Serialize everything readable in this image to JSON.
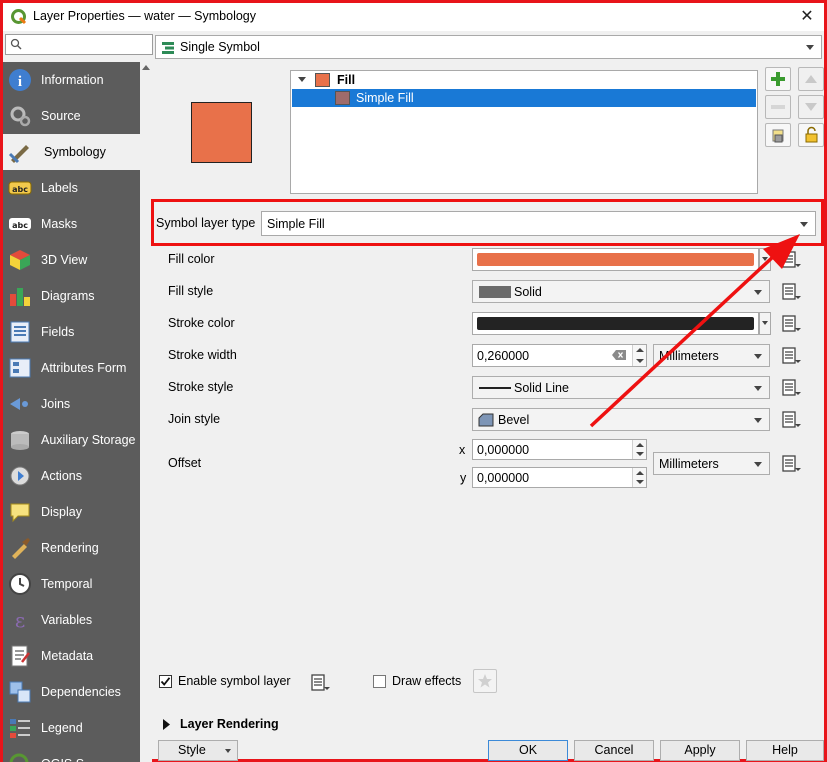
{
  "window": {
    "title": "Layer Properties — water — Symbology"
  },
  "nav": {
    "search_placeholder": "",
    "items": [
      {
        "label": "Information",
        "icon": "info-icon"
      },
      {
        "label": "Source",
        "icon": "source-icon"
      },
      {
        "label": "Symbology",
        "icon": "symbology-icon",
        "active": true
      },
      {
        "label": "Labels",
        "icon": "labels-icon"
      },
      {
        "label": "Masks",
        "icon": "masks-icon"
      },
      {
        "label": "3D View",
        "icon": "3d-view-icon"
      },
      {
        "label": "Diagrams",
        "icon": "diagrams-icon"
      },
      {
        "label": "Fields",
        "icon": "fields-icon"
      },
      {
        "label": "Attributes Form",
        "icon": "attributes-form-icon"
      },
      {
        "label": "Joins",
        "icon": "joins-icon"
      },
      {
        "label": "Auxiliary Storage",
        "icon": "auxiliary-storage-icon"
      },
      {
        "label": "Actions",
        "icon": "actions-icon"
      },
      {
        "label": "Display",
        "icon": "display-icon"
      },
      {
        "label": "Rendering",
        "icon": "rendering-icon"
      },
      {
        "label": "Temporal",
        "icon": "temporal-icon"
      },
      {
        "label": "Variables",
        "icon": "variables-icon"
      },
      {
        "label": "Metadata",
        "icon": "metadata-icon"
      },
      {
        "label": "Dependencies",
        "icon": "dependencies-icon"
      },
      {
        "label": "Legend",
        "icon": "legend-icon"
      },
      {
        "label": "QGIS S",
        "icon": "qgis-server-icon"
      }
    ]
  },
  "renderer": {
    "value": "Single Symbol"
  },
  "symbol_tree": {
    "root_label": "Fill",
    "child_label": "Simple Fill",
    "fill_color": "#e8714a",
    "child_swatch_color": "#9e6b6b"
  },
  "symbol_layer_type": {
    "label": "Symbol layer type",
    "value": "Simple Fill"
  },
  "properties": {
    "fill_color": {
      "label": "Fill color",
      "color": "#e8714a"
    },
    "fill_style": {
      "label": "Fill style",
      "value": "Solid"
    },
    "stroke_color": {
      "label": "Stroke color",
      "color": "#232323"
    },
    "stroke_width": {
      "label": "Stroke width",
      "value": "0,260000",
      "unit": "Millimeters"
    },
    "stroke_style": {
      "label": "Stroke style",
      "value": "Solid Line"
    },
    "join_style": {
      "label": "Join style",
      "value": "Bevel"
    },
    "offset": {
      "label": "Offset",
      "x_label": "x",
      "x_value": "0,000000",
      "y_label": "y",
      "y_value": "0,000000",
      "unit": "Millimeters"
    }
  },
  "bottom": {
    "enable_symbol_layer": "Enable symbol layer",
    "draw_effects": "Draw effects",
    "layer_rendering": "Layer Rendering"
  },
  "buttons": {
    "style": "Style",
    "ok": "OK",
    "cancel": "Cancel",
    "apply": "Apply",
    "help": "Help"
  },
  "colors": {
    "highlight": "#ee1111",
    "selection": "#1979d6",
    "nav_bg": "#5c5c5c"
  }
}
